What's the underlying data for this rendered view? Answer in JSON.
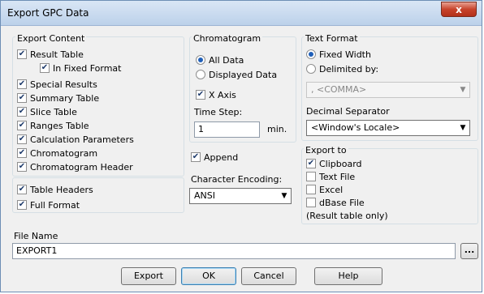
{
  "window": {
    "title": "Export GPC Data",
    "close_glyph": "x"
  },
  "export_content": {
    "title": "Export Content",
    "result_table": "Result Table",
    "in_fixed_format": "In Fixed Format",
    "special_results": "Special Results",
    "summary_table": "Summary Table",
    "slice_table": "Slice Table",
    "ranges_table": "Ranges Table",
    "calculation_parameters": "Calculation Parameters",
    "chromatogram": "Chromatogram",
    "chromatogram_header": "Chromatogram Header",
    "table_headers": "Table Headers",
    "full_format": "Full Format"
  },
  "chromatogram_group": {
    "title": "Chromatogram",
    "all_data": "All Data",
    "displayed_data": "Displayed Data",
    "x_axis": "X Axis",
    "time_step_label": "Time Step:",
    "time_step_value": "1",
    "time_step_unit": "min."
  },
  "append": "Append",
  "character_encoding": {
    "label": "Character Encoding:",
    "value": "ANSI"
  },
  "text_format": {
    "title": "Text Format",
    "fixed_width": "Fixed Width",
    "delimited_by": "Delimited by:",
    "delimiter_value": ", <COMMA>",
    "decimal_separator_label": "Decimal Separator",
    "decimal_separator_value": "<Window's Locale>"
  },
  "export_to": {
    "title": "Export to",
    "clipboard": "Clipboard",
    "text_file": "Text File",
    "excel": "Excel",
    "dbase_file": "dBase File",
    "note": "(Result table only)"
  },
  "file_name": {
    "label": "File Name",
    "value": "EXPORT1",
    "browse": "..."
  },
  "buttons": {
    "export": "Export",
    "ok": "OK",
    "cancel": "Cancel",
    "help": "Help"
  },
  "icons": {
    "check": "checkmark-icon",
    "dropdown": "chevron-down-icon"
  }
}
